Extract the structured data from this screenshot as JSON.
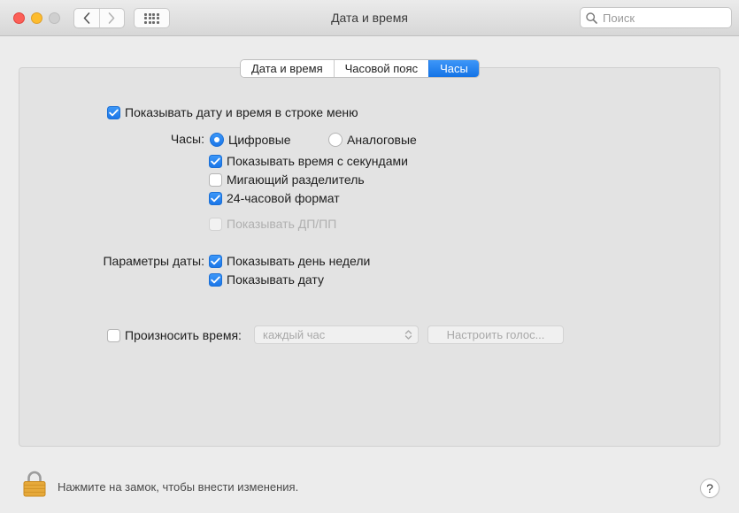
{
  "window": {
    "title": "Дата и время"
  },
  "search": {
    "placeholder": "Поиск"
  },
  "tabs": [
    {
      "label": "Дата и время",
      "active": false
    },
    {
      "label": "Часовой пояс",
      "active": false
    },
    {
      "label": "Часы",
      "active": true
    }
  ],
  "clock": {
    "show_menu": {
      "label": "Показывать дату и время в строке меню",
      "checked": true
    },
    "clock_label": "Часы:",
    "digital": {
      "label": "Цифровые",
      "selected": true
    },
    "analog": {
      "label": "Аналоговые",
      "selected": false
    },
    "seconds": {
      "label": "Показывать время с секундами",
      "checked": true
    },
    "flash": {
      "label": "Мигающий разделитель",
      "checked": false
    },
    "hour24": {
      "label": "24-часовой формат",
      "checked": true
    },
    "ampm": {
      "label": "Показывать ДП/ПП",
      "checked": false,
      "disabled": true
    },
    "date_label": "Параметры даты:",
    "weekday": {
      "label": "Показывать день недели",
      "checked": true
    },
    "date": {
      "label": "Показывать дату",
      "checked": true
    },
    "announce": {
      "label": "Произносить время:",
      "checked": false
    },
    "interval": {
      "value": "каждый час"
    },
    "voice_button": "Настроить голос..."
  },
  "footer": {
    "lock_hint": "Нажмите на замок, чтобы внести изменения.",
    "help_label": "?"
  },
  "colors": {
    "accent": "#1b76e8",
    "close": "#fc5f57",
    "minimize": "#fdbc2e",
    "background": "#ececec"
  }
}
